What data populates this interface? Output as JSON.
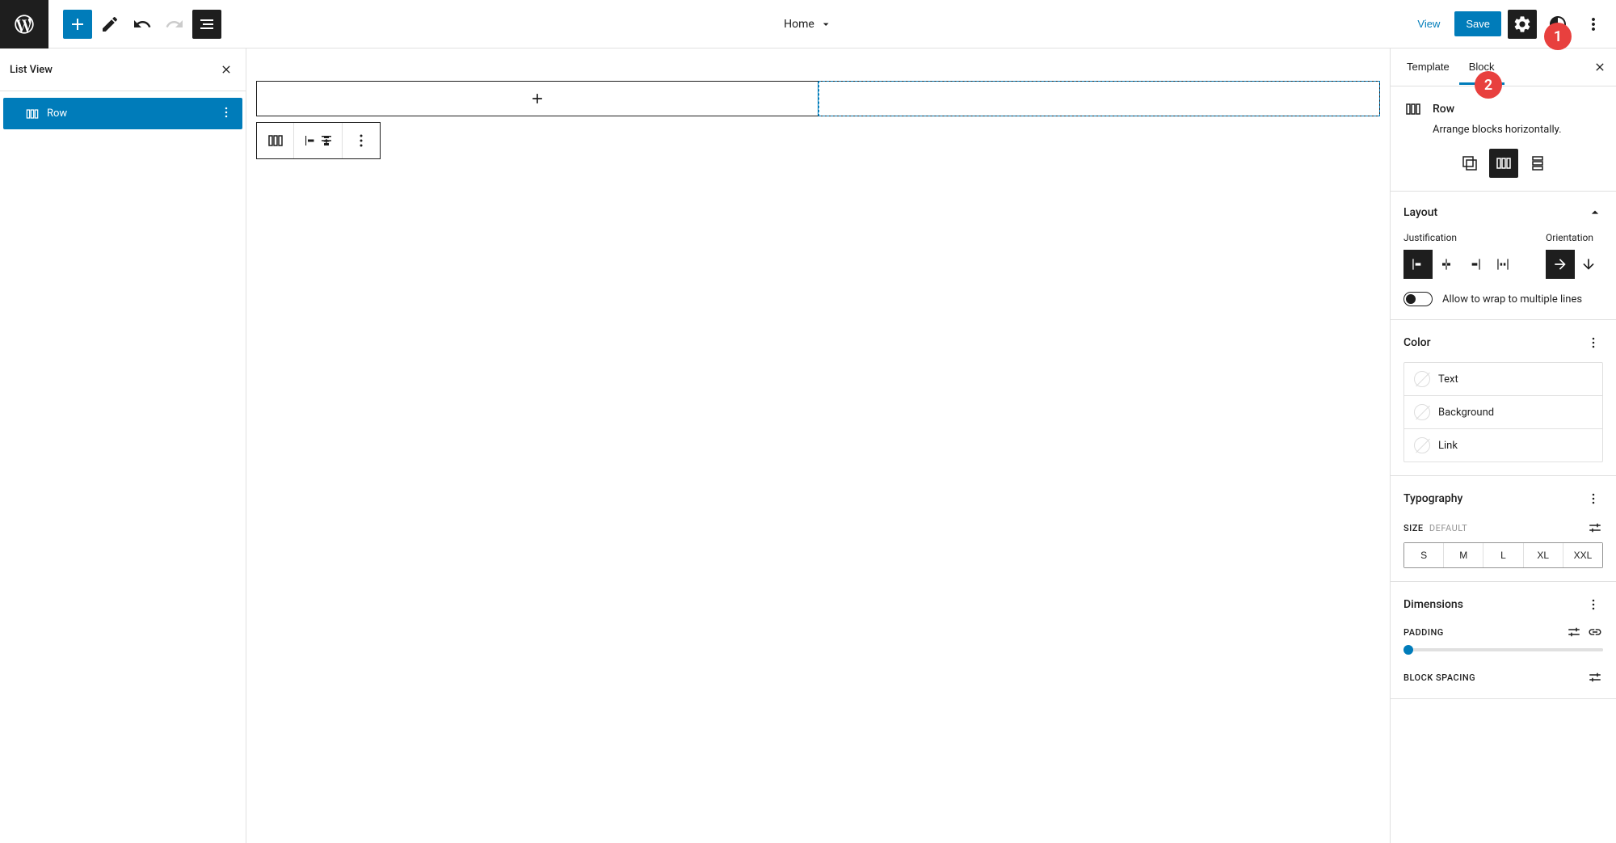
{
  "topbar": {
    "center_title": "Home",
    "view_label": "View",
    "save_label": "Save"
  },
  "listview": {
    "title": "List View",
    "items": [
      {
        "label": "Row"
      }
    ]
  },
  "sidebar": {
    "tabs": {
      "template": "Template",
      "block": "Block"
    },
    "block_info": {
      "name": "Row",
      "description": "Arrange blocks horizontally."
    },
    "layout": {
      "title": "Layout",
      "justification_label": "Justification",
      "orientation_label": "Orientation",
      "wrap_label": "Allow to wrap to multiple lines"
    },
    "color": {
      "title": "Color",
      "items": {
        "text": "Text",
        "background": "Background",
        "link": "Link"
      }
    },
    "typography": {
      "title": "Typography",
      "size_label": "SIZE",
      "size_default": "DEFAULT",
      "sizes": [
        "S",
        "M",
        "L",
        "XL",
        "XXL"
      ]
    },
    "dimensions": {
      "title": "Dimensions",
      "padding_label": "PADDING",
      "spacing_label": "BLOCK SPACING"
    }
  },
  "annotations": {
    "a1": "1",
    "a2": "2"
  }
}
